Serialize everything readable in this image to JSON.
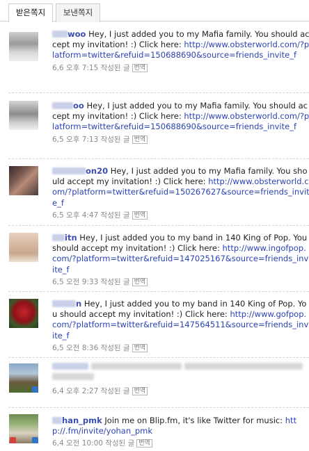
{
  "tabs": [
    {
      "label": "받은쪽지",
      "active": true
    },
    {
      "label": "보낸쪽지",
      "active": false
    }
  ],
  "translate_label": "번역",
  "messages": [
    {
      "sender": "woo",
      "text": " Hey, I just added you to my Mafia family. You should accept my invitation! :) Click here: ",
      "link": "http://www.obsterworld.com/?platform=twitter&refuid=150688690&source=friends_invite_f",
      "time": "6,6 오후 7:15 작성된 글"
    },
    {
      "sender": "oo",
      "text": " Hey, I just added you to my Mafia family. You should accept my invitation! :) Click here: ",
      "link": "http://www.obsterworld.com/?platform=twitter&refuid=150688690&source=friends_invite_f",
      "time": "6,5 오후 7:13 작성된 글"
    },
    {
      "sender": "on20",
      "text": " Hey, I just added you to my Mafia family. You should accept my invitation! :) Click here: ",
      "link": "http://www.obsterworld.com/?platform=twitter&refuid=150267627&source=friends_invite_f",
      "time": "6,5 오후 4:47 작성된 글"
    },
    {
      "sender": "itn",
      "text": " Hey, I just added you to my band in 140 King of Pop. You should accept my invitation! :) Click here: ",
      "link": "http://www.ingofpop.com/?platform=twitter&refuid=147025167&source=friends_invite_f",
      "time": "6,5 오전 9:33 작성된 글"
    },
    {
      "sender": "n",
      "text": " Hey, I just added you to my band in 140 King of Pop. You should accept my invitation! :) Click here: ",
      "link": "http://www.gofpop.com/?platform=twitter&refuid=147564511&source=friends_invite_f",
      "time": "6,5 오전 8:36 작성된 글"
    },
    {
      "sender": "",
      "text": "",
      "link": "",
      "time": "6,4 오후 2:27 작성된 글"
    },
    {
      "sender": "han_pmk",
      "text": " Join me on Blip.fm, it's like Twitter for music: ",
      "link": "http://.fm/invite/yohan_pmk",
      "time": "6,4 오전 10:00 작성된 글"
    }
  ],
  "colors": {
    "link": "#2b43b3",
    "sender": "#3a4db0",
    "meta": "#8a8a8a",
    "border": "#cfcfcf"
  }
}
